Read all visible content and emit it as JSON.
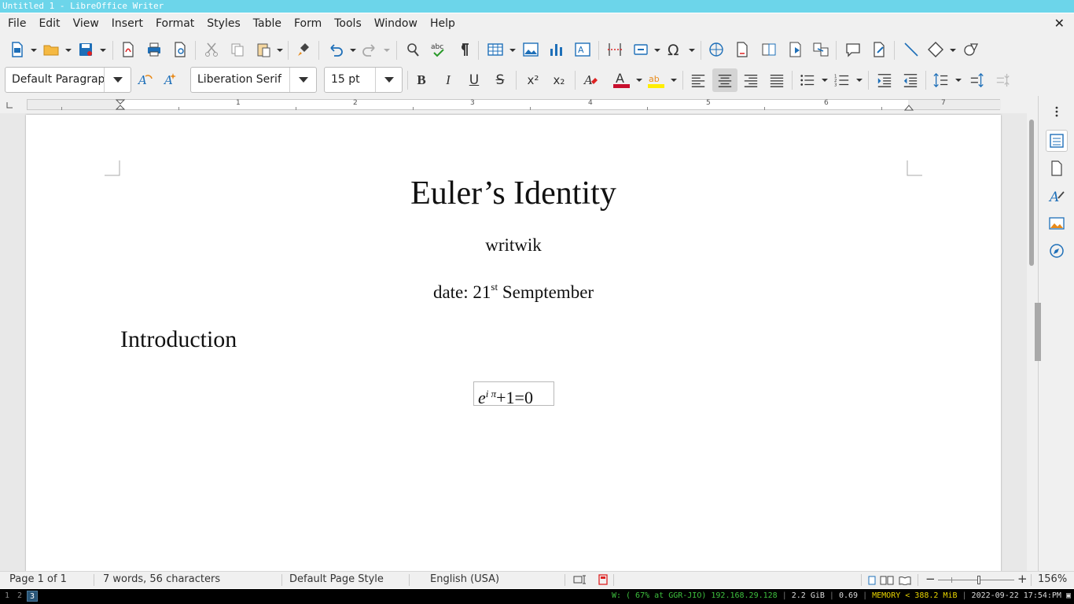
{
  "window": {
    "title": "Untitled 1 - LibreOffice Writer"
  },
  "menubar": {
    "items": [
      "File",
      "Edit",
      "View",
      "Insert",
      "Format",
      "Styles",
      "Table",
      "Form",
      "Tools",
      "Window",
      "Help"
    ],
    "close_glyph": "✕"
  },
  "formatting": {
    "paragraph_style": "Default Paragrap",
    "font_name": "Liberation Serif",
    "font_size": "15 pt",
    "bold": "B",
    "italic": "I",
    "underline": "U",
    "strike": "S",
    "superscript": "x²",
    "subscript": "x₂",
    "font_color": "#c8102e",
    "highlight_color": "#ffee00"
  },
  "ruler": {
    "numbers": [
      "1",
      "2",
      "3",
      "4",
      "5",
      "6",
      "7"
    ]
  },
  "document": {
    "title": "Euler’s Identity",
    "author": "writwik",
    "date_prefix": "date: 21",
    "date_sup": "st",
    "date_suffix": " Semptember",
    "heading": "Introduction",
    "formula": {
      "base": "e",
      "exponent": "i π",
      "rest": "+1=0"
    }
  },
  "statusbar": {
    "page": "Page 1 of 1",
    "words": "7 words, 56 characters",
    "page_style": "Default Page Style",
    "language": "English (USA)",
    "zoom": "156%"
  },
  "taskbar": {
    "workspaces": [
      "1",
      "2",
      "3"
    ],
    "active_workspace": "3",
    "wifi": "W: ( 67% at GGR-JIO) 192.168.29.128",
    "disk": "2.2 GiB",
    "load": "0.69",
    "memory": "MEMORY < 388.2 MiB",
    "datetime": "2022-09-22 17:54:PM"
  },
  "icons": {
    "toolbar1": [
      "new-document-icon",
      "open-folder-icon",
      "save-icon",
      "export-pdf-icon",
      "print-icon",
      "print-preview-icon",
      "cut-icon",
      "copy-icon",
      "paste-icon",
      "clone-formatting-icon",
      "undo-icon",
      "redo-icon",
      "find-replace-icon",
      "spelling-icon",
      "formatting-marks-icon",
      "insert-table-icon",
      "insert-image-icon",
      "insert-chart-icon",
      "insert-textbox-icon",
      "page-break-icon",
      "insert-field-icon",
      "special-character-icon",
      "hyperlink-icon",
      "footnote-icon",
      "endnote-icon",
      "bookmark-icon",
      "cross-reference-icon",
      "comment-icon",
      "track-changes-icon",
      "line-icon",
      "basic-shapes-icon",
      "draw-functions-icon"
    ],
    "sidebar": [
      "properties-icon",
      "page-icon",
      "styles-icon",
      "gallery-icon",
      "navigator-icon"
    ]
  }
}
